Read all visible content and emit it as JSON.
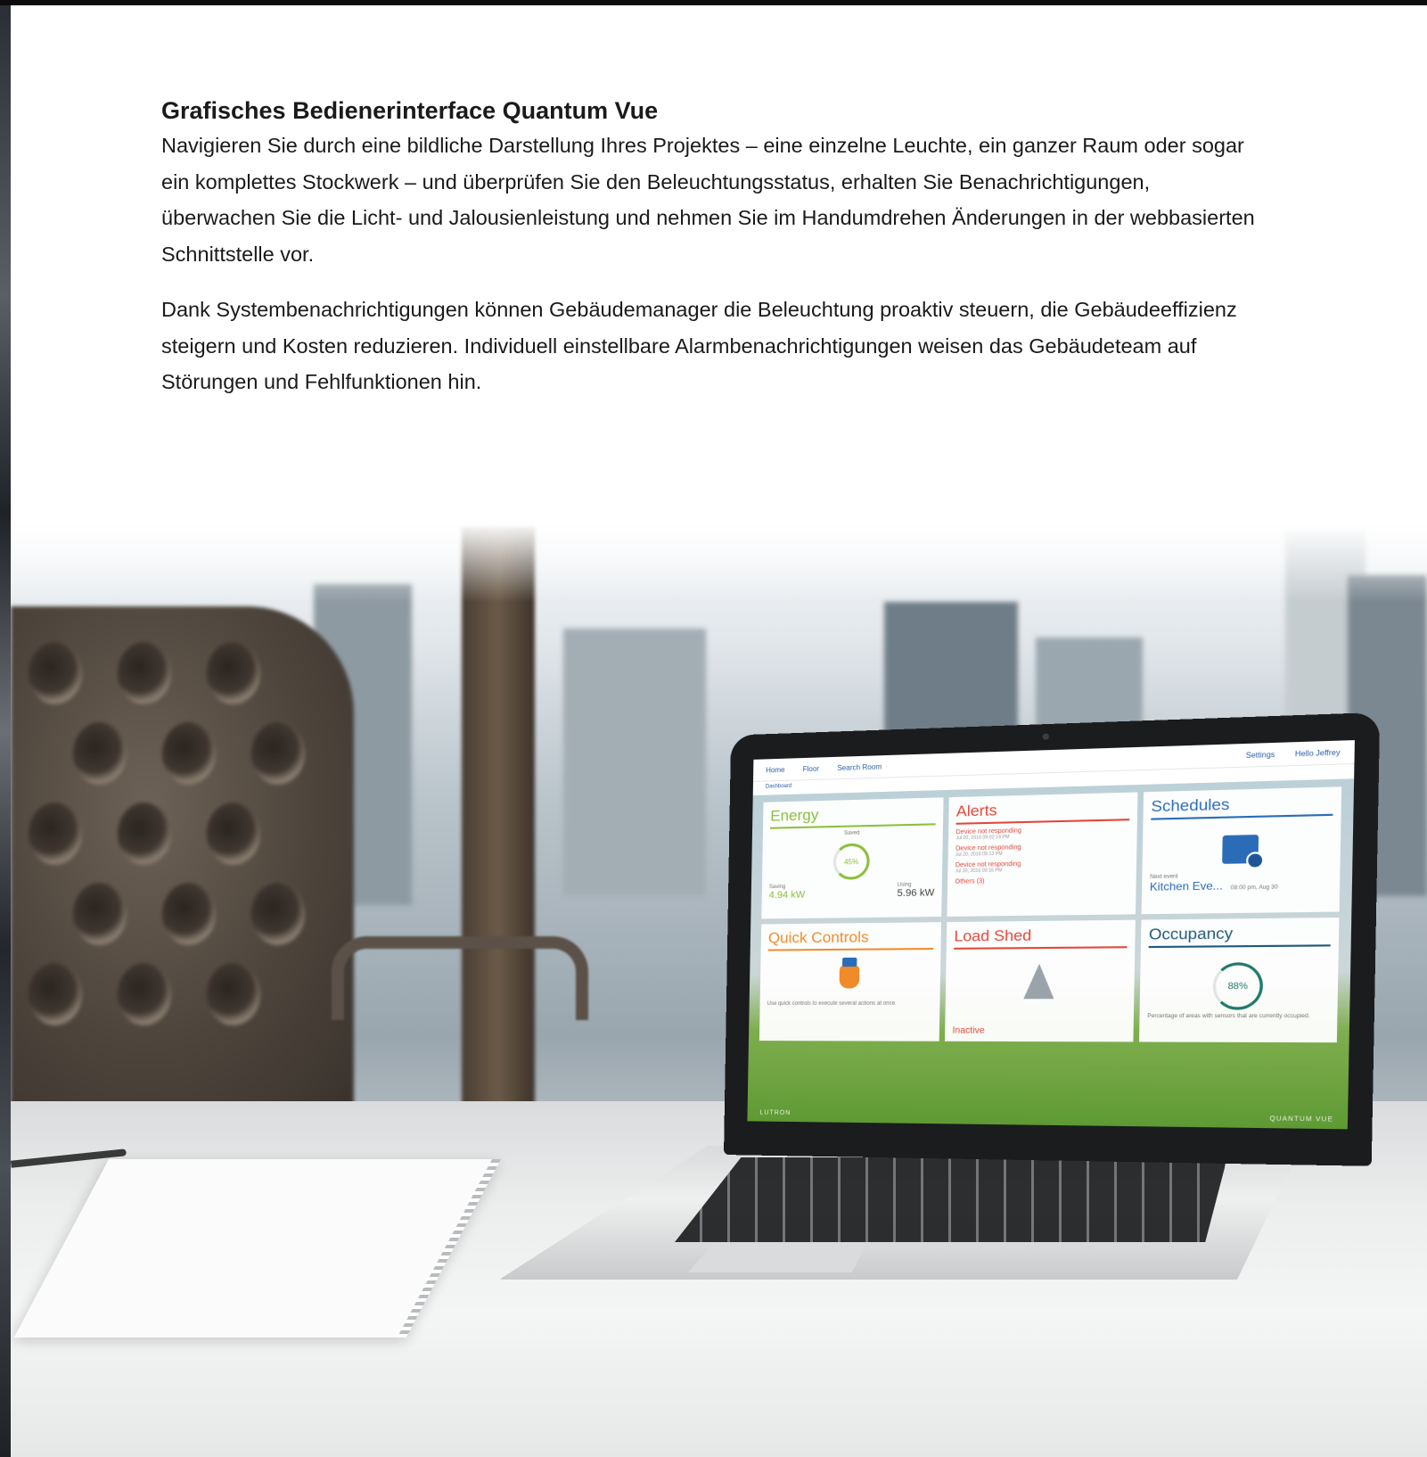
{
  "document": {
    "heading": "Grafisches Bedienerinterface Quantum Vue",
    "paragraphs": [
      "Navigieren Sie durch eine bildliche Darstellung Ihres Projektes – eine einzelne Leuchte, ein ganzer Raum oder sogar ein komplettes Stockwerk – und überprüfen Sie den Beleuchtungsstatus, erhalten Sie Benachrichtigungen, überwachen Sie die Licht- und Jalousienleistung und nehmen Sie im Handumdrehen Änderungen in der webbasierten Schnittstelle vor.",
      "Dank Systembenachrichtigungen können Gebäudemanager die Beleuchtung proaktiv steuern, die Gebäudeeffizienz steigern und Kosten reduzieren. Individuell einstellbare Alarmbenachrichtigungen weisen das Gebäudeteam auf Störungen und Fehlfunktionen hin."
    ]
  },
  "laptop_screen": {
    "nav": {
      "home": "Home",
      "floor": "Floor",
      "search": "Search Room",
      "settings": "Settings",
      "user": "Hello Jeffrey"
    },
    "breadcrumb": "Dashboard",
    "tiles": {
      "energy": {
        "title": "Energy",
        "label": "Saved",
        "percent": "45%",
        "left_label": "Saving",
        "left_value": "4.94 kW",
        "right_label": "Using",
        "right_value": "5.96 kW"
      },
      "alerts": {
        "title": "Alerts",
        "items": [
          {
            "text": "Device not responding",
            "date": "Jul 20, 2016 09:02:14 PM"
          },
          {
            "text": "Device not responding",
            "date": "Jul 20, 2016 09:13 PM"
          },
          {
            "text": "Device not responding",
            "date": "Jul 20, 2016 09:16 PM"
          }
        ],
        "others": "Others (3)"
      },
      "schedules": {
        "title": "Schedules",
        "next_label": "Next event",
        "next_event": "Kitchen Eve...",
        "next_time": "08:00 pm, Aug 30"
      },
      "quick_controls": {
        "title": "Quick Controls",
        "caption": "Use quick controls to execute several actions at once."
      },
      "load_shed": {
        "title": "Load Shed",
        "status": "Inactive"
      },
      "occupancy": {
        "title": "Occupancy",
        "percent": "88%",
        "caption": "Percentage of areas with sensors that are currently occupied."
      }
    },
    "brand_left": "LUTRON",
    "brand_right": "QUANTUM VUE"
  },
  "colors": {
    "energy": "#8bbf3a",
    "alerts": "#e0483a",
    "schedules": "#2b6cb8",
    "quick_controls": "#f08b2a",
    "occupancy": "#1e7a6a",
    "text": "#1a1a1a"
  }
}
